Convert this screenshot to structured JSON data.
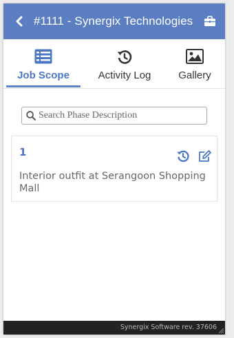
{
  "header": {
    "back_icon": "chevron-left-icon",
    "title": "#1111 -  Synergix Technologies",
    "action_icon": "briefcase-icon"
  },
  "tabs": [
    {
      "label": "Job Scope",
      "icon": "list-icon",
      "active": true
    },
    {
      "label": "Activity Log",
      "icon": "history-icon",
      "active": false
    },
    {
      "label": "Gallery",
      "icon": "image-icon",
      "active": false
    }
  ],
  "search": {
    "placeholder": "Search Phase Description",
    "value": ""
  },
  "phases": [
    {
      "number": "1",
      "description": "Interior outfit at Serangoon Shopping Mall",
      "actions": [
        "history-icon",
        "edit-icon"
      ]
    }
  ],
  "footer": {
    "text": "Synergix Software rev. 37606"
  },
  "colors": {
    "header_bg": "#5b7ec2",
    "accent": "#4a76c4",
    "footer_bg": "#222222"
  }
}
